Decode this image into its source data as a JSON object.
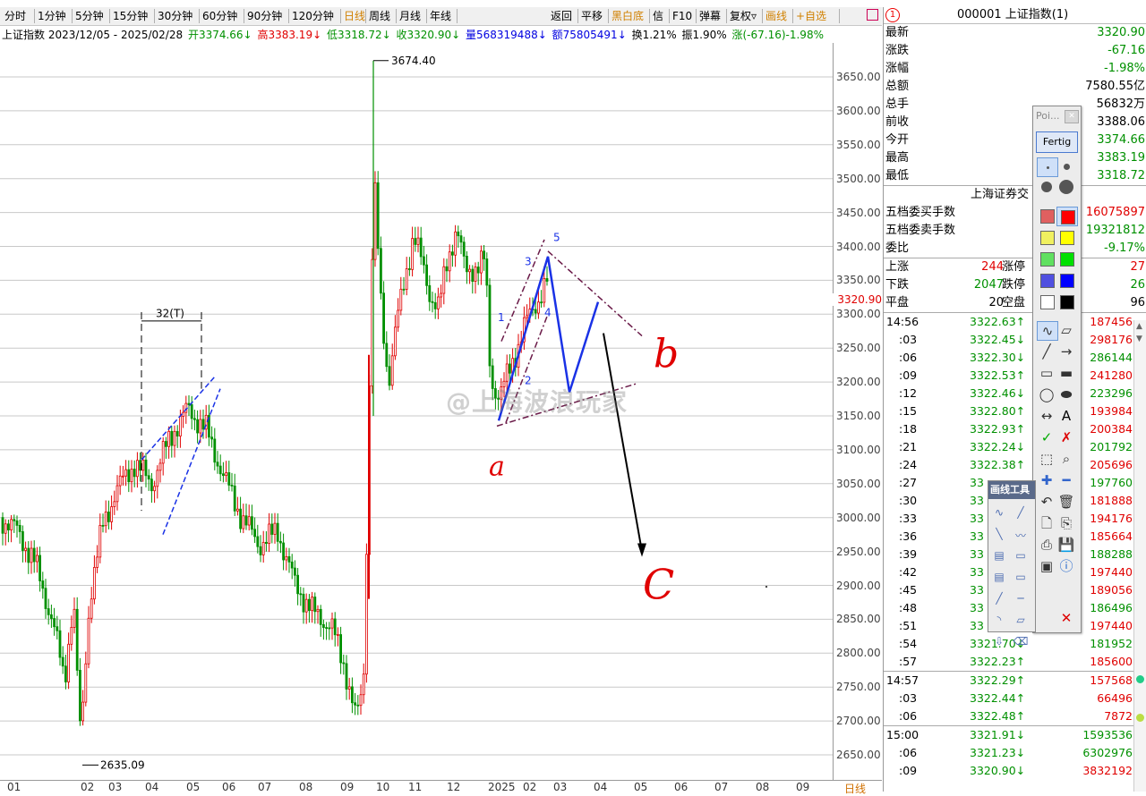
{
  "toolbar": {
    "left_tabs": [
      "分时",
      "1分钟",
      "5分钟",
      "15分钟",
      "30分钟",
      "60分钟",
      "90分钟",
      "120分钟",
      "日线",
      "周线",
      "月线",
      "年线"
    ],
    "right_tabs": [
      "返回",
      "平移",
      "黑白底",
      "信",
      "F10",
      "弹幕",
      "复权▿",
      "画线",
      "+自选"
    ],
    "square_icon": "square-outline-icon"
  },
  "info": {
    "name_range": "上证指数 2023/12/05 - 2025/02/28",
    "open": "开3374.66↓",
    "high": "高3383.19↓",
    "low": "低3318.72↓",
    "close": "收3320.90↓",
    "volume": "量568319488↓",
    "amount": "额75805491↓",
    "turnover": "换1.21%",
    "amplitude": "振1.90%",
    "change": "涨(-67.16)-1.98%"
  },
  "chart_data": {
    "type": "candlestick",
    "y_ticks": [
      "3650.00",
      "3600.00",
      "3550.00",
      "3500.00",
      "3450.00",
      "3400.00",
      "3350.00",
      "3300.00",
      "3250.00",
      "3200.00",
      "3150.00",
      "3100.00",
      "3050.00",
      "3000.00",
      "2950.00",
      "2900.00",
      "2850.00",
      "2800.00",
      "2750.00",
      "2700.00",
      "2650.00"
    ],
    "ylim": [
      2630,
      3680
    ],
    "x_ticks": [
      "01",
      "02",
      "03",
      "04",
      "05",
      "06",
      "07",
      "08",
      "09",
      "10",
      "11",
      "12",
      "2025",
      "02",
      "03",
      "04",
      "05",
      "06",
      "07",
      "08",
      "09"
    ],
    "x_right_label": "日线",
    "current_price": "3320.90",
    "high_label": "3674.40",
    "low_label": "2635.09",
    "annotations": {
      "bracket_label": "32(T)",
      "wave_numbers": [
        "1",
        "2",
        "3",
        "4",
        "5"
      ],
      "handwritten": [
        "a",
        "b",
        "C"
      ]
    },
    "watermark": "@上海波浪玩家",
    "colors": {
      "up": "#e00000",
      "down": "#009000",
      "annotation_blue": "#1a32e6",
      "annotation_purple": "#6a1a48",
      "handwritten": "#e00000"
    }
  },
  "panel": {
    "title": "000001 上证指数(1)",
    "badge": "1",
    "quotes": [
      {
        "k": "最新",
        "v": "3320.90",
        "c": "g"
      },
      {
        "k": "涨跌",
        "v": "-67.16",
        "c": "g"
      },
      {
        "k": "涨幅",
        "v": "-1.98%",
        "c": "g"
      },
      {
        "k": "总额",
        "v": "7580.55亿",
        "c": "b"
      },
      {
        "k": "总手",
        "v": "56832万",
        "c": "b"
      },
      {
        "k": "前收",
        "v": "3388.06",
        "c": "b"
      },
      {
        "k": "今开",
        "v": "3374.66",
        "c": "g"
      },
      {
        "k": "最高",
        "v": "3383.19",
        "c": "g"
      },
      {
        "k": "最低",
        "v": "3318.72",
        "c": "g"
      }
    ],
    "exchange": "上海证券交",
    "orders": [
      {
        "k": "五档委买手数",
        "v": "16075897",
        "c": "r"
      },
      {
        "k": "五档委卖手数",
        "v": "19321812",
        "c": "g"
      },
      {
        "k": "委比",
        "v": "-9.17%",
        "c": "g"
      }
    ],
    "breadth": [
      {
        "k": "上涨",
        "n": "244",
        "m": "涨停",
        "v": "27",
        "nc": "r",
        "vc": "r"
      },
      {
        "k": "下跌",
        "n": "2047",
        "m": "跌停",
        "v": "26",
        "nc": "g",
        "vc": "g"
      },
      {
        "k": "平盘",
        "n": "20",
        "m": "空盘",
        "v": "96",
        "nc": "b",
        "vc": "b"
      }
    ],
    "ticks": [
      {
        "t": "14:56",
        "p": "3322.63↑",
        "v": "187456",
        "pc": "g",
        "vc": "r"
      },
      {
        "t": ":03",
        "p": "3322.45↓",
        "v": "298176",
        "pc": "g",
        "vc": "r"
      },
      {
        "t": ":06",
        "p": "3322.30↓",
        "v": "286144",
        "pc": "g",
        "vc": "g"
      },
      {
        "t": ":09",
        "p": "3322.53↑",
        "v": "241280",
        "pc": "g",
        "vc": "r"
      },
      {
        "t": ":12",
        "p": "3322.46↓",
        "v": "223296",
        "pc": "g",
        "vc": "g"
      },
      {
        "t": ":15",
        "p": "3322.80↑",
        "v": "193984",
        "pc": "g",
        "vc": "r"
      },
      {
        "t": ":18",
        "p": "3322.93↑",
        "v": "200384",
        "pc": "g",
        "vc": "r"
      },
      {
        "t": ":21",
        "p": "3322.24↓",
        "v": "201792",
        "pc": "g",
        "vc": "g"
      },
      {
        "t": ":24",
        "p": "3322.38↑",
        "v": "205696",
        "pc": "g",
        "vc": "r"
      },
      {
        "t": ":27",
        "p": "33",
        "v": "197760",
        "pc": "g",
        "vc": "g"
      },
      {
        "t": ":30",
        "p": "33",
        "v": "181888",
        "pc": "g",
        "vc": "r"
      },
      {
        "t": ":33",
        "p": "33",
        "v": "194176",
        "pc": "g",
        "vc": "r"
      },
      {
        "t": ":36",
        "p": "33",
        "v": "185664",
        "pc": "g",
        "vc": "r"
      },
      {
        "t": ":39",
        "p": "33",
        "v": "188288",
        "pc": "g",
        "vc": "g"
      },
      {
        "t": ":42",
        "p": "33",
        "v": "197440",
        "pc": "g",
        "vc": "r"
      },
      {
        "t": ":45",
        "p": "33",
        "v": "189056",
        "pc": "g",
        "vc": "r"
      },
      {
        "t": ":48",
        "p": "33",
        "v": "186496",
        "pc": "g",
        "vc": "g"
      },
      {
        "t": ":51",
        "p": "33",
        "v": "197440",
        "pc": "g",
        "vc": "r"
      },
      {
        "t": ":54",
        "p": "3321.70↓",
        "v": "181952",
        "pc": "g",
        "vc": "g"
      },
      {
        "t": ":57",
        "p": "3322.23↑",
        "v": "185600",
        "pc": "g",
        "vc": "r"
      },
      {
        "t": "14:57",
        "p": "3322.29↑",
        "v": "157568",
        "pc": "g",
        "vc": "r"
      },
      {
        "t": ":03",
        "p": "3322.44↑",
        "v": "66496",
        "pc": "g",
        "vc": "r"
      },
      {
        "t": ":06",
        "p": "3322.48↑",
        "v": "7872",
        "pc": "g",
        "vc": "r"
      },
      {
        "t": "15:00",
        "p": "3321.91↓",
        "v": "1593536",
        "pc": "g",
        "vc": "g"
      },
      {
        "t": ":06",
        "p": "3321.23↓",
        "v": "6302976",
        "pc": "g",
        "vc": "g"
      },
      {
        "t": ":09",
        "p": "3320.90↓",
        "v": "3832192",
        "pc": "g",
        "vc": "r"
      }
    ]
  },
  "draw_tool": {
    "title": "Poi...",
    "done_label": "Fertig",
    "sub_title": "画线工具",
    "palette": [
      "#e06060",
      "#ff0000",
      "#f0f060",
      "#ffff00",
      "#60e060",
      "#00e000",
      "#5050e0",
      "#0000ff",
      "#ffffff",
      "#000000"
    ],
    "icons": [
      "small-dot-icon",
      "medium-dot-icon",
      "large-dot-icon",
      "xl-dot-icon",
      "pen-icon",
      "eraser-icon",
      "line-icon",
      "arrow-icon",
      "rectangle-icon",
      "filled-rectangle-icon",
      "ellipse-icon",
      "filled-ellipse-icon",
      "double-arrow-icon",
      "text-icon",
      "check-icon",
      "cross-icon",
      "crop-icon",
      "zoom-icon",
      "plus-icon",
      "minus-icon",
      "undo-icon",
      "trash-icon",
      "new-file-icon",
      "copy-icon",
      "print-icon",
      "save-icon",
      "image-icon",
      "info-icon",
      "close-icon"
    ],
    "text_tool": "A"
  }
}
